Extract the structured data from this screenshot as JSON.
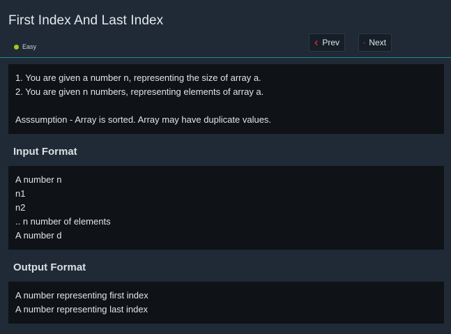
{
  "header": {
    "title": "First Index And Last Index",
    "difficulty": "Easy",
    "difficulty_color": "#a8c81a",
    "prev_label": "Prev",
    "next_label": "Next",
    "accent_color": "#e0253b"
  },
  "description": {
    "lines": [
      "1. You are given a number n, representing the size of array a.",
      "2. You are given n numbers, representing elements of array a."
    ],
    "assumption": "Asssumption - Array is sorted. Array may have duplicate values."
  },
  "input_format": {
    "heading": "Input Format",
    "lines": [
      "A number n",
      "n1",
      "n2",
      ".. n number of elements",
      "A number d"
    ]
  },
  "output_format": {
    "heading": "Output Format",
    "lines": [
      "A number representing first index",
      "A number representing last index"
    ]
  }
}
